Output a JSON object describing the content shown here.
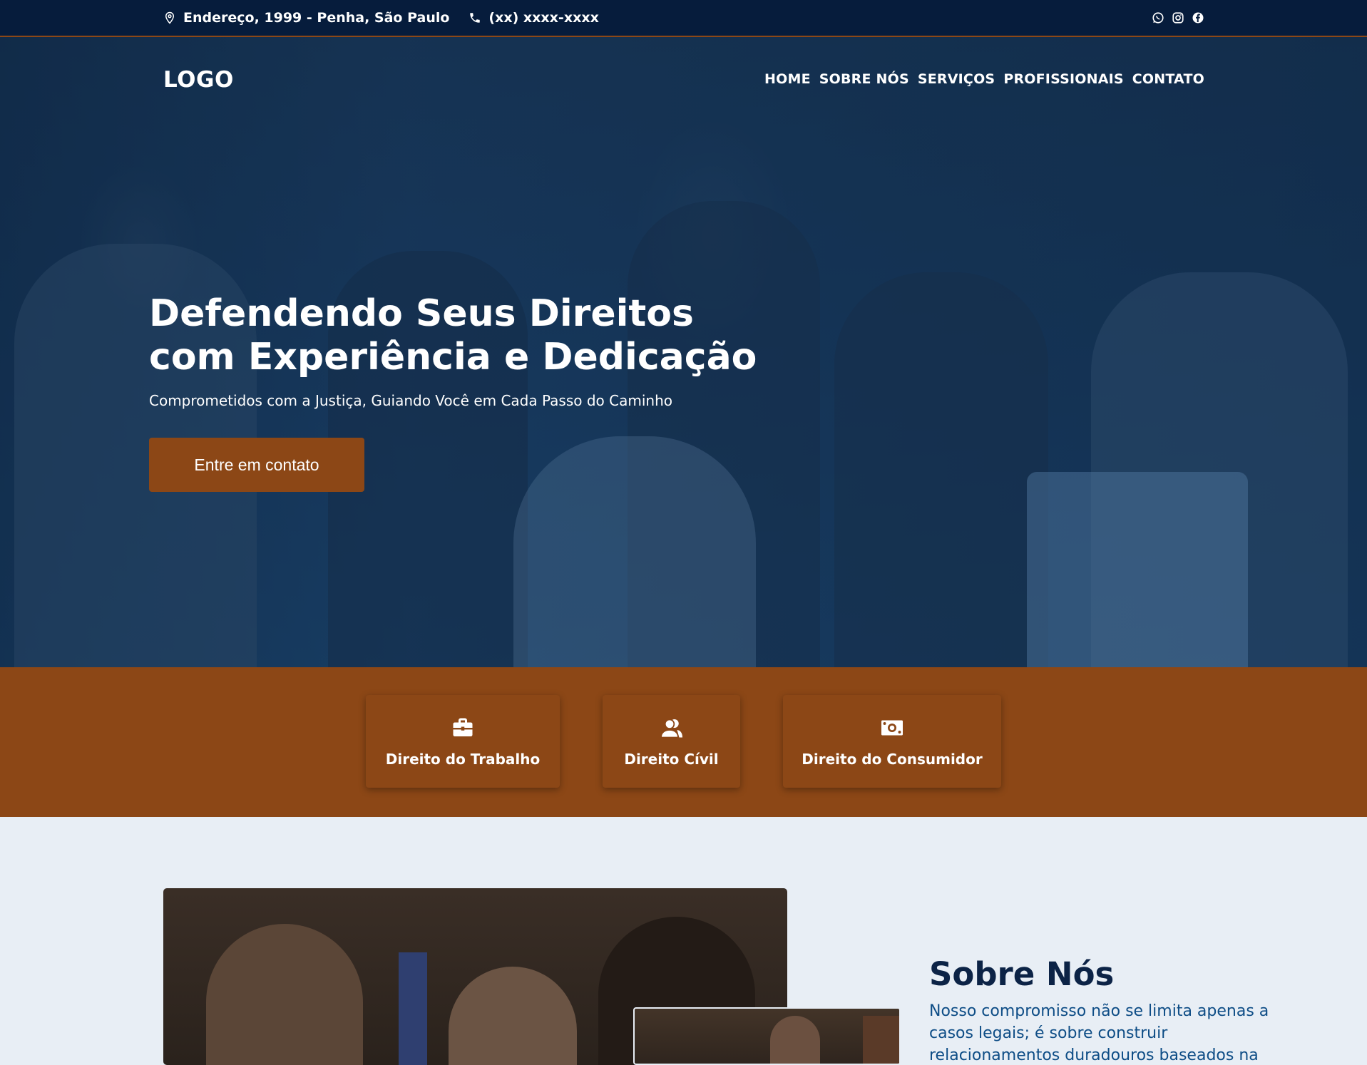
{
  "topbar": {
    "address": "Endereço, 1999 - Penha, São Paulo",
    "phone": "(xx) xxxx-xxxx",
    "social_icons": [
      "whatsapp-icon",
      "instagram-icon",
      "facebook-icon"
    ]
  },
  "header": {
    "logo": "LOGO",
    "nav": [
      "HOME",
      "SOBRE NÓS",
      "SERVIÇOS",
      "PROFISSIONAIS",
      "CONTATO"
    ]
  },
  "hero": {
    "headline": "Defendendo Seus Direitos com Experiência e Dedicação",
    "subheadline": "Comprometidos com a Justiça, Guiando Você em Cada Passo do Caminho",
    "cta_label": "Entre em contato"
  },
  "services": [
    {
      "label": "Direito do Trabalho",
      "icon": "briefcase-icon"
    },
    {
      "label": "Direito Cívil",
      "icon": "users-icon"
    },
    {
      "label": "Direito do Consumidor",
      "icon": "money-icon"
    }
  ],
  "about": {
    "title": "Sobre Nós",
    "text": "Nosso compromisso não se limita apenas a casos legais; é sobre construir relacionamentos duradouros baseados na"
  },
  "colors": {
    "navy": "#061c3c",
    "accent_brown": "#8c4716",
    "about_title": "#0c2346",
    "about_text": "#0e4d86",
    "page_bg": "#e8eef5"
  }
}
